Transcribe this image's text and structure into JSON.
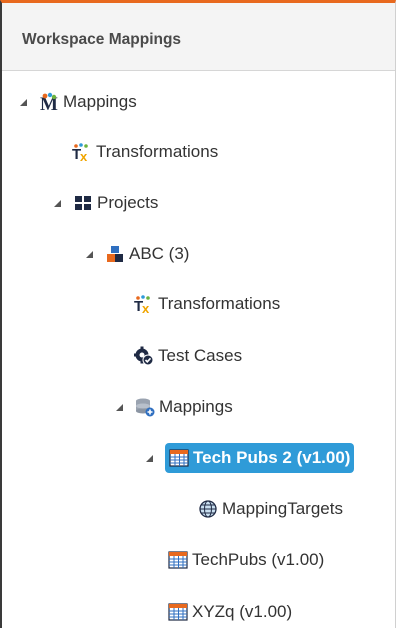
{
  "panel": {
    "title": "Workspace Mappings"
  },
  "tree": {
    "mappings_root": {
      "label": "Mappings",
      "icon": "mapping-manager-icon"
    },
    "transformations_root": {
      "label": "Transformations",
      "icon": "transformation-icon"
    },
    "projects": {
      "label": "Projects",
      "icon": "projects-grid-icon"
    },
    "abc": {
      "label": "ABC (3)",
      "icon": "project-icon"
    },
    "transformations_abc": {
      "label": "Transformations",
      "icon": "transformation-icon"
    },
    "test_cases": {
      "label": "Test Cases",
      "icon": "test-cases-icon"
    },
    "mappings_folder": {
      "label": "Mappings",
      "icon": "mappings-db-icon"
    },
    "tech_pubs_2": {
      "label": "Tech Pubs 2 (v1.00)",
      "icon": "mapping-table-icon",
      "selected": true
    },
    "mapping_targets": {
      "label": "MappingTargets",
      "icon": "globe-icon"
    },
    "techpubs": {
      "label": "TechPubs (v1.00)",
      "icon": "mapping-table-icon"
    },
    "xyzq": {
      "label": "XYZq (v1.00)",
      "icon": "mapping-table-icon"
    }
  },
  "colors": {
    "accent_top": "#e8691e",
    "selection": "#2f9bd8"
  }
}
